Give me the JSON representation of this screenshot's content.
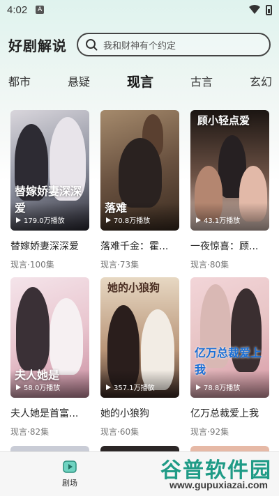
{
  "status": {
    "time": "4:02",
    "notif": "A"
  },
  "header": {
    "app_title": "好剧解说",
    "search_placeholder": "我和财神有个约定"
  },
  "tabs": [
    "都市",
    "悬疑",
    "现言",
    "古言",
    "玄幻"
  ],
  "active_tab_index": 2,
  "dramas": [
    {
      "title": "替嫁娇妻深深爱",
      "meta": "现言·100集",
      "plays": "179.0万播放",
      "poster_text": "替嫁娇妻深深爱",
      "colors": [
        "#2b2a34",
        "#8b8f9d",
        "#d9d6dc"
      ]
    },
    {
      "title": "落难千金：霍...",
      "meta": "现言·73集",
      "plays": "70.8万播放",
      "poster_text": "落难",
      "colors": [
        "#3a2b20",
        "#6a5240",
        "#a58a6c"
      ]
    },
    {
      "title": "一夜惊喜：顾...",
      "meta": "现言·80集",
      "plays": "43.1万播放",
      "poster_text": "顾小轻点爱",
      "colors": [
        "#1b1512",
        "#6d5245",
        "#d8c1b8"
      ]
    },
    {
      "title": "夫人她是首富...",
      "meta": "现言·82集",
      "plays": "58.0万播放",
      "poster_text": "夫人她是",
      "colors": [
        "#e9c6cf",
        "#c98da0",
        "#f4e4ea"
      ]
    },
    {
      "title": "她的小狼狗",
      "meta": "现言·60集",
      "plays": "357.1万播放",
      "poster_text": "她的小狼狗",
      "colors": [
        "#e7d8c3",
        "#b99578",
        "#3c2a24"
      ]
    },
    {
      "title": "亿万总裁爱上我",
      "meta": "现言·92集",
      "plays": "78.8万播放",
      "poster_text": "亿万总裁爱上我",
      "colors": [
        "#f2d5d8",
        "#d79aa6",
        "#e8c5c6"
      ]
    }
  ],
  "bottom_nav": {
    "label": "剧场"
  },
  "watermark": {
    "title": "谷普软件园",
    "url": "www.gupuxiazai.com"
  }
}
